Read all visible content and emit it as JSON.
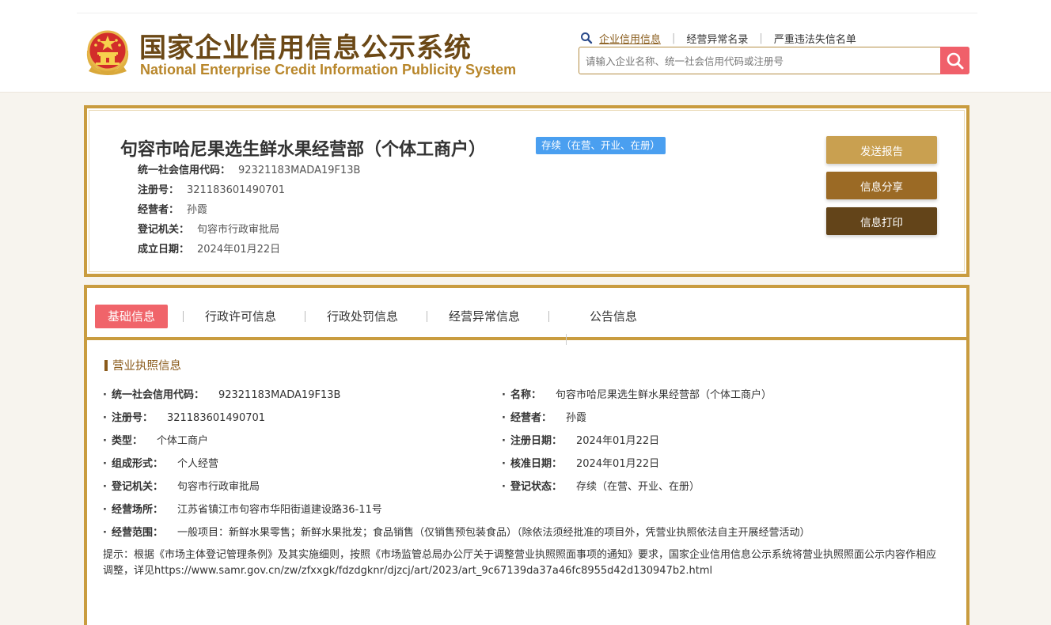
{
  "site": {
    "title": "国家企业信用信息公示系统",
    "subtitle": "National Enterprise Credit Information Publicity System"
  },
  "nav": {
    "links": [
      "企业信用信息",
      "经营异常名录",
      "严重违法失信名单"
    ],
    "separators": [
      "|",
      "|"
    ]
  },
  "search": {
    "placeholder": "请输入企业名称、统一社会信用代码或注册号",
    "value": ""
  },
  "enterprise": {
    "name": "句容市哈尼果选生鲜水果经营部（个体工商户）",
    "status": "存续（在营、开业、在册）",
    "fields": [
      {
        "label": "统一社会信用代码：",
        "value": "92321183MADA19F13B"
      },
      {
        "label": "注册号：",
        "value": "321183601490701"
      },
      {
        "label": "经营者：",
        "value": "孙霞"
      },
      {
        "label": "登记机关：",
        "value": "句容市行政审批局"
      },
      {
        "label": "成立日期：",
        "value": "2024年01月22日"
      }
    ]
  },
  "actions": {
    "send_report": "发送报告",
    "share": "信息分享",
    "print": "信息打印"
  },
  "tabs": [
    "基础信息",
    "行政许可信息",
    "行政处罚信息",
    "经营异常信息",
    "公告信息"
  ],
  "license": {
    "section_title": "营业执照信息",
    "bullet": "·",
    "left": [
      {
        "label": "统一社会信用代码：",
        "value": "92321183MADA19F13B"
      },
      {
        "label": "注册号：",
        "value": "321183601490701"
      },
      {
        "label": "类型：",
        "value": "个体工商户"
      },
      {
        "label": "组成形式：",
        "value": "个人经营"
      },
      {
        "label": "登记机关：",
        "value": "句容市行政审批局"
      }
    ],
    "right": [
      {
        "label": "名称：",
        "value": "句容市哈尼果选生鲜水果经营部（个体工商户）"
      },
      {
        "label": "经营者：",
        "value": "孙霞"
      },
      {
        "label": "注册日期：",
        "value": "2024年01月22日"
      },
      {
        "label": "核准日期：",
        "value": "2024年01月22日"
      },
      {
        "label": "登记状态：",
        "value": "存续（在营、开业、在册）"
      }
    ],
    "full": [
      {
        "label": "经营场所：",
        "value": "江苏省镇江市句容市华阳街道建设路36-11号"
      },
      {
        "label": "经营范围：",
        "value": "一般项目：新鲜水果零售；新鲜水果批发；食品销售（仅销售预包装食品）（除依法须经批准的项目外，凭营业执照依法自主开展经营活动）"
      }
    ],
    "tip": "提示：根据《市场主体登记管理条例》及其实施细则，按照《市场监管总局办公厅关于调整营业执照照面事项的通知》要求，国家企业信用信息公示系统将营业执照照面公示内容作相应调整，详见https://www.samr.gov.cn/zw/zfxxgk/fdzdgknr/djzcj/art/2023/art_9c67139da37a46fc8955d42d130947b2.html"
  },
  "colors": {
    "brand_brown": "#6b4816",
    "gold_border": "#c99c3f",
    "status_blue": "#4a9ff0",
    "active_tab": "#f0646a",
    "send_btn": "#c9a050",
    "share_btn": "#9b6a25",
    "print_btn": "#634419"
  }
}
